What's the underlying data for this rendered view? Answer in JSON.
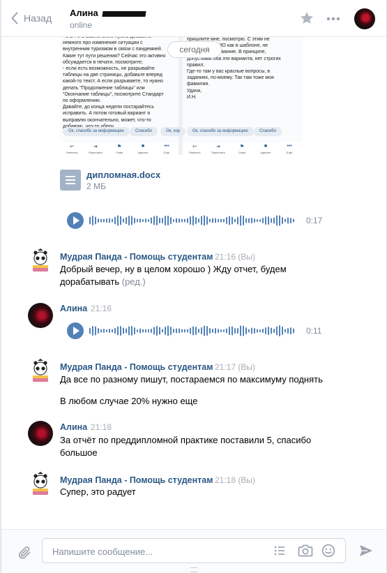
{
  "header": {
    "back_label": "Назад",
    "peer_name": "Алина",
    "peer_status": "online",
    "icons": [
      "chevron-left-icon",
      "star-icon",
      "more-icon"
    ]
  },
  "date_separator": "сегодня",
  "screenshot_fragment": {
    "left_column": [
      "- в 2.4 и в Заключение нужно добавить",
      "немного про изменение ситуации с",
      "внутренним туризмом в связи с пандемией.",
      "Какие тут пути решения? Сейчас это активно",
      "обсуждается в печати, посмотрите;",
      "- если есть возможность, не разрывайте",
      "таблицы на две страницы, добавьте вперед",
      "какой-то текст. А если разрываете, то нужно",
      "делать \"Продолжение таблицы\" или",
      "\"Окончание таблицы\", посмотрите Стандарт",
      "по оформлению.",
      "Давайте, до конца недели постарайтесь",
      "исправить. А потом готовый вариант я",
      "выправлю окончательно, может, что-то",
      "добавлю, что-то уберу."
    ],
    "right_column": [
      "пришлите мне, посмотрю. С этим не",
      "ФИО как в шаблоне, не",
      "обращайте внимание. В принципе,",
      "допустимы оба эти варианта, нет строгих",
      "правил.",
      "Где-то там у вас красные вопросы, в",
      "заданиях, по-моему. Так там тоже моя",
      "фамилия.",
      "Удачи,",
      "И.Н."
    ],
    "quick_replies_left": [
      "Ок, спасибо за информацию",
      "Спасибо",
      "Ок, хор"
    ],
    "quick_replies_right": [
      "Ок, спасибо за информацию",
      "Спасибо"
    ],
    "toolbar_labels": [
      "Ответить",
      "Переслать",
      "Спам",
      "Удалить",
      "Еще"
    ]
  },
  "document": {
    "name": "дипломная.docx",
    "size": "2 МБ"
  },
  "voice_top": {
    "duration": "0:17"
  },
  "messages": [
    {
      "author": "Мудрая Панда - Помощь студентам",
      "time": "21:16 (Вы)",
      "text": "Добрый вечер, ну в целом хорошо ) Жду отчет, будем дорабатывать",
      "edited": "(ред.)"
    },
    {
      "author": "Алина",
      "time": "21:16",
      "voice_duration": "0:11"
    },
    {
      "author": "Мудрая Панда - Помощь студентам",
      "time": "21:17 (Вы)",
      "text": "Да все по разному пишут, постараемся по максимуму поднять",
      "text2": "В любом случае 20% нужно еще"
    },
    {
      "author": "Алина",
      "time": "21:18",
      "text": "За отчёт по преддипломной практике поставили 5, спасибо большое"
    },
    {
      "author": "Мудрая Панда - Помощь студентам",
      "time": "21:18 (Вы)",
      "text": "Супер, это радует"
    }
  ],
  "composer": {
    "placeholder": "Напишите сообщение...",
    "icons": [
      "paperclip-icon",
      "list-icon",
      "camera-icon",
      "smile-icon",
      "send-icon"
    ]
  },
  "colors": {
    "accent": "#5181b8",
    "link": "#2a5885",
    "muted": "#818c99",
    "background": "#edeef0"
  }
}
